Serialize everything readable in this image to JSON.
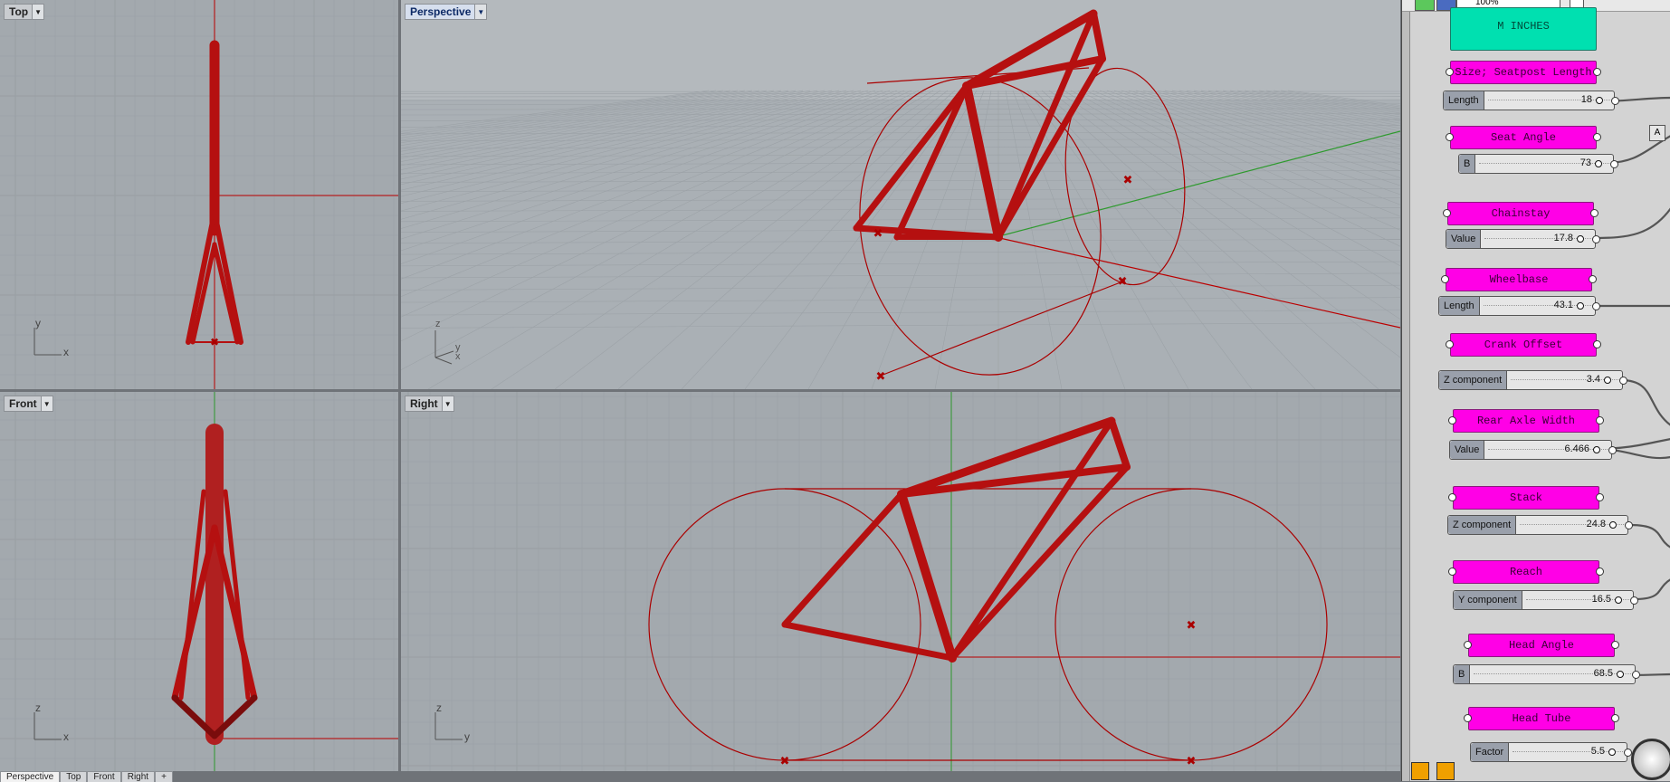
{
  "viewports": {
    "top": {
      "title": "Top"
    },
    "perspective": {
      "title": "Perspective"
    },
    "front": {
      "title": "Front"
    },
    "right": {
      "title": "Right"
    }
  },
  "viewport_tabs": [
    "Perspective",
    "Top",
    "Front",
    "Right"
  ],
  "axes": {
    "top": {
      "h": "x",
      "v": "y"
    },
    "perspective": {
      "a": "z",
      "b": "y",
      "c": "x"
    },
    "front": {
      "h": "x",
      "v": "z"
    },
    "right": {
      "h": "y",
      "v": "z"
    }
  },
  "grasshopper": {
    "zoom": "100%",
    "units_label": "M INCHES",
    "corner_box": "A",
    "components": [
      {
        "group": "Size; Seatpost Length",
        "slider_name": "Length",
        "value": "18"
      },
      {
        "group": "Seat Angle",
        "slider_name": "B",
        "value": "73"
      },
      {
        "group": "Chainstay",
        "slider_name": "Value",
        "value": "17.8"
      },
      {
        "group": "Wheelbase",
        "slider_name": "Length",
        "value": "43.1"
      },
      {
        "group": "Crank Offset",
        "slider_name": "Z component",
        "value": "3.4"
      },
      {
        "group": "Rear Axle Width",
        "slider_name": "Value",
        "value": "6.466"
      },
      {
        "group": "Stack",
        "slider_name": "Z component",
        "value": "24.8"
      },
      {
        "group": "Reach",
        "slider_name": "Y component",
        "value": "16.5"
      },
      {
        "group": "Head Angle",
        "slider_name": "B",
        "value": "68.5"
      },
      {
        "group": "Head Tube",
        "slider_name": "Factor",
        "value": "5.5"
      }
    ]
  },
  "colors": {
    "frame": "#c01010",
    "viewport_bg": "#a3a9ae",
    "grid": "#989ea3",
    "group": "#ff00e6",
    "teal": "#00e0b0"
  }
}
